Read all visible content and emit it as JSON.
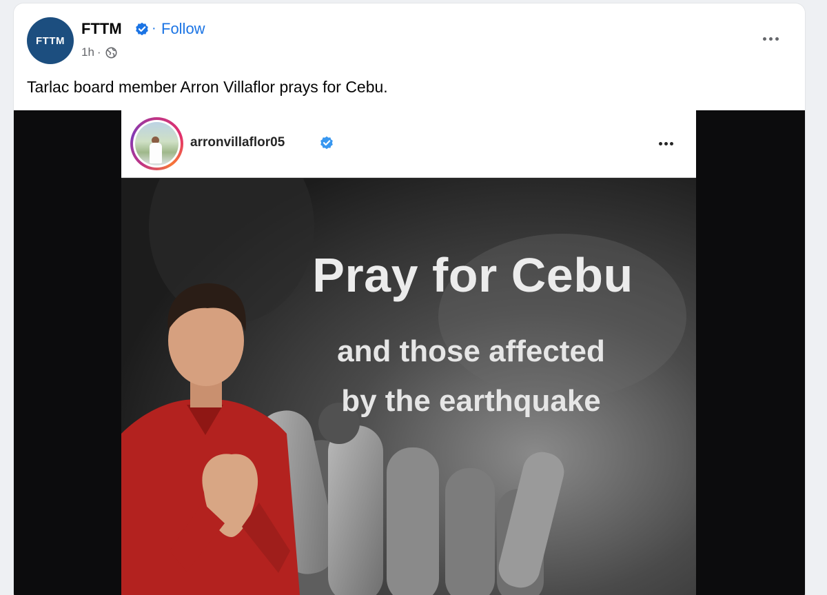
{
  "post": {
    "page_name": "FTTM",
    "avatar_text": "FTTM",
    "follow_label": "Follow",
    "separator": "·",
    "timestamp": "1h",
    "meta_separator": "·",
    "audience_icon": "globe-icon",
    "caption": "Tarlac board member Arron Villaflor prays for Cebu.",
    "verified_icon": "verified-badge-icon",
    "more_icon": "more-options-icon"
  },
  "media": {
    "username": "arronvillaflor05",
    "verified_icon": "verified-badge-icon",
    "more_icon": "more-options-icon",
    "headline": "Pray for Cebu",
    "subline_1": "and those affected",
    "subline_2": "by the earthquake"
  },
  "colors": {
    "brand_blue": "#1b74e4",
    "avatar_bg": "#1c4e7f",
    "shirt_red": "#b3221f"
  }
}
